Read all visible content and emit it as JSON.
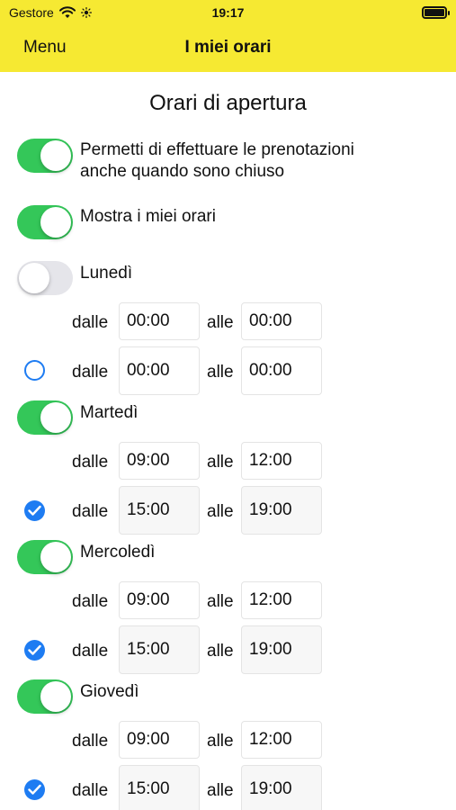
{
  "status_bar": {
    "carrier": "Gestore",
    "time": "19:17"
  },
  "nav": {
    "menu_label": "Menu",
    "title": "I miei orari"
  },
  "section_title": "Orari di apertura",
  "settings": {
    "allow_booking_closed": {
      "label_line1": "Permetti di effettuare le prenotazioni",
      "label_line2": "anche quando sono chiuso",
      "enabled": true
    },
    "show_hours": {
      "label": "Mostra i miei orari",
      "enabled": true
    }
  },
  "word_from": "dalle",
  "word_to": "alle",
  "days": [
    {
      "name": "Lunedì",
      "enabled": false,
      "slots": [
        {
          "from": "00:00",
          "to": "00:00"
        },
        {
          "from": "00:00",
          "to": "00:00",
          "checked": false
        }
      ]
    },
    {
      "name": "Martedì",
      "enabled": true,
      "slots": [
        {
          "from": "09:00",
          "to": "12:00"
        },
        {
          "from": "15:00",
          "to": "19:00",
          "checked": true
        }
      ]
    },
    {
      "name": "Mercoledì",
      "enabled": true,
      "slots": [
        {
          "from": "09:00",
          "to": "12:00"
        },
        {
          "from": "15:00",
          "to": "19:00",
          "checked": true
        }
      ]
    },
    {
      "name": "Giovedì",
      "enabled": true,
      "slots": [
        {
          "from": "09:00",
          "to": "12:00"
        },
        {
          "from": "15:00",
          "to": "19:00",
          "checked": true
        }
      ]
    }
  ],
  "colors": {
    "header": "#f6e932",
    "toggle_on": "#34c759",
    "toggle_off": "#e5e5ea",
    "check": "#1e7cf2"
  },
  "icons": [
    "wifi-icon",
    "brightness-icon",
    "battery-icon",
    "check-icon"
  ]
}
